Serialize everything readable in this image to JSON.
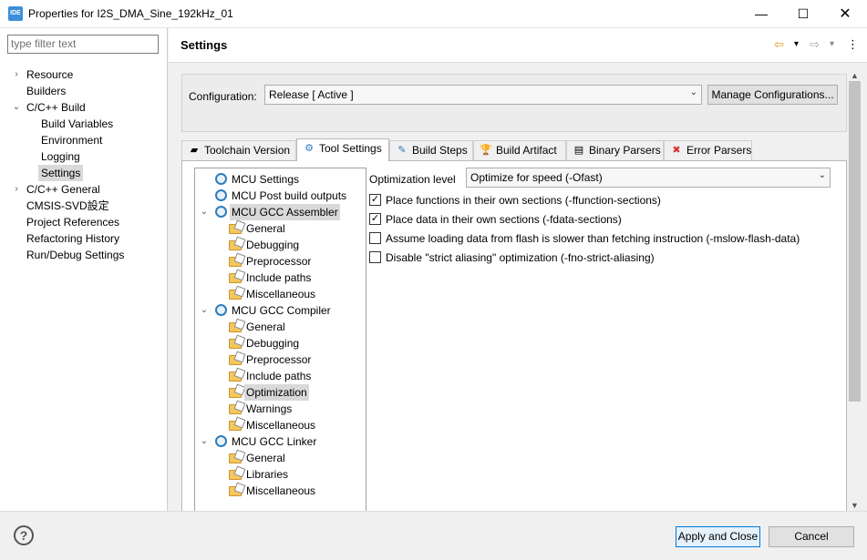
{
  "window": {
    "app_icon_text": "IDE",
    "title": "Properties for I2S_DMA_Sine_192kHz_01",
    "minimize": "—",
    "maximize": "☐",
    "close": "✕"
  },
  "nav": {
    "filter_placeholder": "type filter text",
    "items": [
      {
        "label": "Resource",
        "twisty": "›"
      },
      {
        "label": "Builders"
      },
      {
        "label": "C/C++ Build",
        "twisty": "⌄"
      },
      {
        "label": "Build Variables"
      },
      {
        "label": "Environment"
      },
      {
        "label": "Logging"
      },
      {
        "label": "Settings"
      },
      {
        "label": "C/C++ General",
        "twisty": "›"
      },
      {
        "label": "CMSIS-SVD設定"
      },
      {
        "label": "Project References"
      },
      {
        "label": "Refactoring History"
      },
      {
        "label": "Run/Debug Settings"
      }
    ]
  },
  "header": {
    "title": "Settings",
    "back_icon": "⇦",
    "forward_icon": "⇨",
    "dropdown_icon": "▾",
    "menu_icon": "⋮"
  },
  "configuration": {
    "label": "Configuration:",
    "value": "Release  [ Active ]",
    "manage_button": "Manage Configurations..."
  },
  "tabs": [
    {
      "label": "Toolchain Version",
      "icon": "▰"
    },
    {
      "label": "Tool Settings",
      "icon": "⚙"
    },
    {
      "label": "Build Steps",
      "icon": "✎"
    },
    {
      "label": "Build Artifact",
      "icon": "🏆"
    },
    {
      "label": "Binary Parsers",
      "icon": "▤"
    },
    {
      "label": "Error Parsers",
      "icon": "✖"
    }
  ],
  "tool_tree": {
    "twisty_open": "⌄",
    "items": [
      {
        "label": "MCU Settings"
      },
      {
        "label": "MCU Post build outputs"
      },
      {
        "label": "MCU GCC Assembler"
      },
      {
        "label": "General"
      },
      {
        "label": "Debugging"
      },
      {
        "label": "Preprocessor"
      },
      {
        "label": "Include paths"
      },
      {
        "label": "Miscellaneous"
      },
      {
        "label": "MCU GCC Compiler"
      },
      {
        "label": "General"
      },
      {
        "label": "Debugging"
      },
      {
        "label": "Preprocessor"
      },
      {
        "label": "Include paths"
      },
      {
        "label": "Optimization"
      },
      {
        "label": "Warnings"
      },
      {
        "label": "Miscellaneous"
      },
      {
        "label": "MCU GCC Linker"
      },
      {
        "label": "General"
      },
      {
        "label": "Libraries"
      },
      {
        "label": "Miscellaneous"
      }
    ]
  },
  "optimization": {
    "level_label": "Optimization level",
    "level_value": "Optimize for speed (-Ofast)",
    "options": [
      {
        "label": "Place functions in their own sections (-ffunction-sections)",
        "checked": true,
        "mark": "✓"
      },
      {
        "label": "Place data in their own sections (-fdata-sections)",
        "checked": true,
        "mark": "✓"
      },
      {
        "label": "Assume loading data from flash is slower than fetching instruction (-mslow-flash-data)",
        "checked": false,
        "mark": ""
      },
      {
        "label": "Disable \"strict aliasing\" optimization (-fno-strict-aliasing)",
        "checked": false,
        "mark": ""
      }
    ]
  },
  "footer": {
    "help_icon": "?",
    "apply_button": "Apply and Close",
    "cancel_button": "Cancel"
  }
}
